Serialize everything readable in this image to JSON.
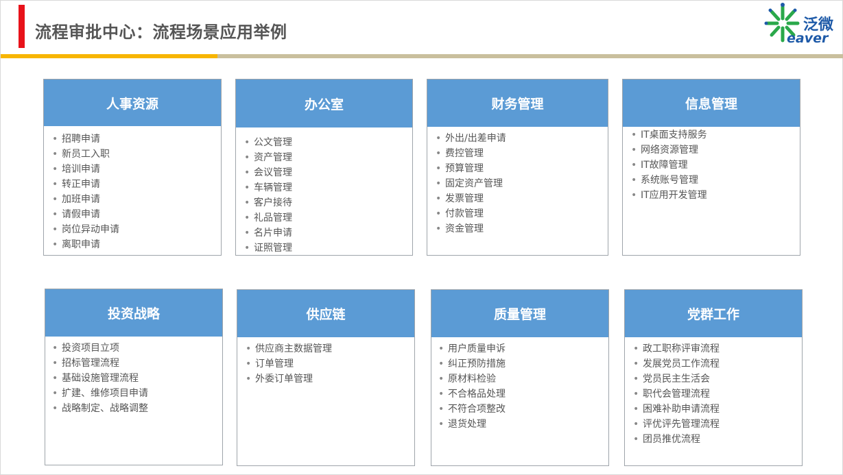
{
  "header": {
    "title": "流程审批中心：流程场景应用举例",
    "logo": {
      "icon": "star-burst-logo-icon",
      "brand_cn": "泛微",
      "brand_en": "eaver",
      "color": "#1e5aa8",
      "accent": "#2aa84a"
    }
  },
  "colors": {
    "card_header": "#5b9bd5",
    "title_marker": "#e8121a",
    "rule_left": "#f7b500",
    "rule_right": "#c9bf9d"
  },
  "categories": [
    {
      "title": "人事资源",
      "items": [
        "招聘申请",
        "新员工入职",
        "培训申请",
        "转正申请",
        "加班申请",
        "请假申请",
        "岗位异动申请",
        "离职申请"
      ]
    },
    {
      "title": "办公室",
      "items": [
        "公文管理",
        "资产管理",
        "会议管理",
        "车辆管理",
        "客户接待",
        "礼品管理",
        "名片申请",
        "证照管理"
      ]
    },
    {
      "title": "财务管理",
      "items": [
        "外出/出差申请",
        "费控管理",
        "预算管理",
        "固定资产管理",
        "发票管理",
        "付款管理",
        "资金管理"
      ]
    },
    {
      "title": "信息管理",
      "items": [
        "IT桌面支持服务",
        "网络资源管理",
        "IT故障管理",
        "系统账号管理",
        "IT应用开发管理"
      ]
    },
    {
      "title": "投资战略",
      "items": [
        "投资项目立项",
        "招标管理流程",
        "基础设施管理流程",
        "扩建、维修项目申请",
        "战略制定、战略调整"
      ]
    },
    {
      "title": "供应链",
      "items": [
        "供应商主数据管理",
        "订单管理",
        "外委订单管理"
      ]
    },
    {
      "title": "质量管理",
      "items": [
        "用户质量申诉",
        "纠正预防措施",
        "原材料检验",
        "不合格品处理",
        "不符合项整改",
        "退货处理"
      ]
    },
    {
      "title": "党群工作",
      "items": [
        "政工职称评审流程",
        "发展党员工作流程",
        "党员民主生活会",
        "职代会管理流程",
        "困难补助申请流程",
        "评优评先管理流程",
        "团员推优流程"
      ]
    }
  ]
}
